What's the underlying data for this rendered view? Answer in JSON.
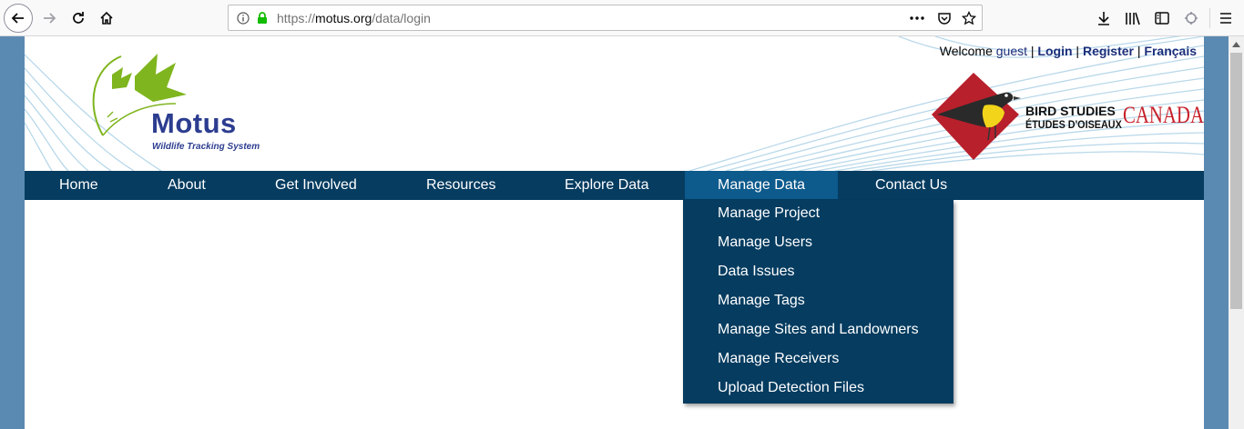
{
  "browser": {
    "url_prefix": "https://",
    "url_host": "motus.org",
    "url_path": "/data/login",
    "icons": [
      "back-icon",
      "forward-icon",
      "reload-icon",
      "home-icon",
      "info-icon",
      "lock-icon",
      "more-icon",
      "pocket-icon",
      "bookmark-star-icon",
      "download-icon",
      "library-icon",
      "sidebar-icon",
      "extension-icon",
      "menu-icon"
    ]
  },
  "header": {
    "welcome": "Welcome",
    "user": "guest",
    "sep": "|",
    "login": "Login",
    "register": "Register",
    "language": "Français"
  },
  "logo": {
    "title": "Motus",
    "subtitle": "Wildlife Tracking System"
  },
  "partner": {
    "line1": "BIRD STUDIES",
    "line2": "ÉTUDES D'OISEAUX",
    "line3": "CANADA"
  },
  "nav": {
    "items": [
      "Home",
      "About",
      "Get Involved",
      "Resources",
      "Explore Data",
      "Manage Data",
      "Contact Us"
    ],
    "active": "Manage Data"
  },
  "dropdown": {
    "items": [
      "Manage Project",
      "Manage Users",
      "Data Issues",
      "Manage Tags",
      "Manage Sites and Landowners",
      "Manage Receivers",
      "Upload Detection Files"
    ]
  },
  "colors": {
    "nav_bg": "#053c60",
    "nav_active": "#0d5a8c",
    "page_bg": "#5a8ab2",
    "motus_blue": "#2c3d90",
    "leaf_green": "#7fb51e",
    "bsc_red": "#c8202a"
  }
}
